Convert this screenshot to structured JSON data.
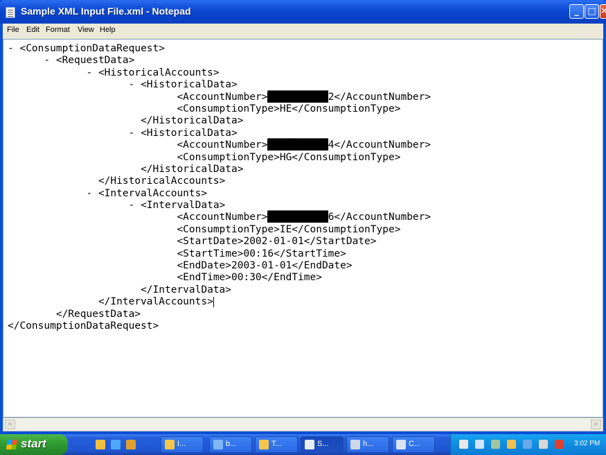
{
  "window": {
    "title": "Sample XML Input File.xml - Notepad",
    "app_icon": "notepad-icon",
    "controls": {
      "minimize": "_",
      "maximize": "□",
      "close": "✕"
    }
  },
  "menu": [
    "File",
    "Edit",
    "Format",
    "View",
    "Help"
  ],
  "document": {
    "lines": [
      {
        "indent": "- ",
        "before": "<ConsumptionDataRequest>"
      },
      {
        "indent": "      - ",
        "before": "<RequestData>"
      },
      {
        "indent": "             - ",
        "before": "<HistoricalAccounts>"
      },
      {
        "indent": "                    - ",
        "before": "<HistoricalData>"
      },
      {
        "indent": "                            ",
        "before": "<AccountNumber>",
        "redacted": "██████████",
        "after": "2</AccountNumber>"
      },
      {
        "indent": "                            ",
        "before": "<ConsumptionType>HE</ConsumptionType>"
      },
      {
        "indent": "                      ",
        "before": "</HistoricalData>"
      },
      {
        "indent": "                    - ",
        "before": "<HistoricalData>"
      },
      {
        "indent": "                            ",
        "before": "<AccountNumber>",
        "redacted": "██████████",
        "after": "4</AccountNumber>"
      },
      {
        "indent": "                            ",
        "before": "<ConsumptionType>HG</ConsumptionType>"
      },
      {
        "indent": "                      ",
        "before": "</HistoricalData>"
      },
      {
        "indent": "               ",
        "before": "</HistoricalAccounts>"
      },
      {
        "indent": "             - ",
        "before": "<IntervalAccounts>"
      },
      {
        "indent": "                    - ",
        "before": "<IntervalData>"
      },
      {
        "indent": "                            ",
        "before": "<AccountNumber>",
        "redacted": "██████████",
        "after": "6</AccountNumber>"
      },
      {
        "indent": "                            ",
        "before": "<ConsumptionType>IE</ConsumptionType>"
      },
      {
        "indent": "                            ",
        "before": "<StartDate>2002-01-01</StartDate>"
      },
      {
        "indent": "                            ",
        "before": "<StartTime>00:16</StartTime>"
      },
      {
        "indent": "                            ",
        "before": "<EndDate>2003-01-01</EndDate>"
      },
      {
        "indent": "                            ",
        "before": "<EndTime>00:30</EndTime>"
      },
      {
        "indent": "                      ",
        "before": "</IntervalData>"
      },
      {
        "indent": "               ",
        "before": "</IntervalAccounts>",
        "caret": true
      },
      {
        "indent": "        ",
        "before": "</RequestData>"
      },
      {
        "indent": "",
        "before": "</ConsumptionDataRequest>"
      }
    ]
  },
  "scrollbar": {
    "left_arrow": "<",
    "right_arrow": ">"
  },
  "taskbar": {
    "start_label": "start",
    "quick_launch": [
      {
        "icon": "folder-icon",
        "color": "#f0c040"
      },
      {
        "icon": "ie-icon",
        "color": "#4fa8ff"
      },
      {
        "icon": "users-icon",
        "color": "#e0a030"
      }
    ],
    "tasks": [
      {
        "label": "I...",
        "icon": "folder-icon",
        "color": "#f4c74a"
      },
      {
        "label": "b...",
        "icon": "browser-icon",
        "color": "#7fb8f5"
      },
      {
        "label": "T...",
        "icon": "folder-icon",
        "color": "#f4c74a"
      },
      {
        "label": "S...",
        "icon": "notepad-icon",
        "color": "#e8eef8",
        "active": true
      },
      {
        "label": "h...",
        "icon": "document-icon",
        "color": "#cfd8e8"
      },
      {
        "label": "C...",
        "icon": "app-icon",
        "color": "#d8e4f4"
      }
    ],
    "tray_icons": [
      {
        "icon": "network-icon",
        "color": "#e8e8e8"
      },
      {
        "icon": "monitor-icon",
        "color": "#cfe4ff"
      },
      {
        "icon": "tool-icon",
        "color": "#a0c8a0"
      },
      {
        "icon": "folder-icon",
        "color": "#f0c050"
      },
      {
        "icon": "globe-icon",
        "color": "#6aa8e8"
      },
      {
        "icon": "shield-icon",
        "color": "#d8d8d8"
      },
      {
        "icon": "security-icon",
        "color": "#e04030"
      }
    ],
    "clock": "3:02 PM"
  }
}
